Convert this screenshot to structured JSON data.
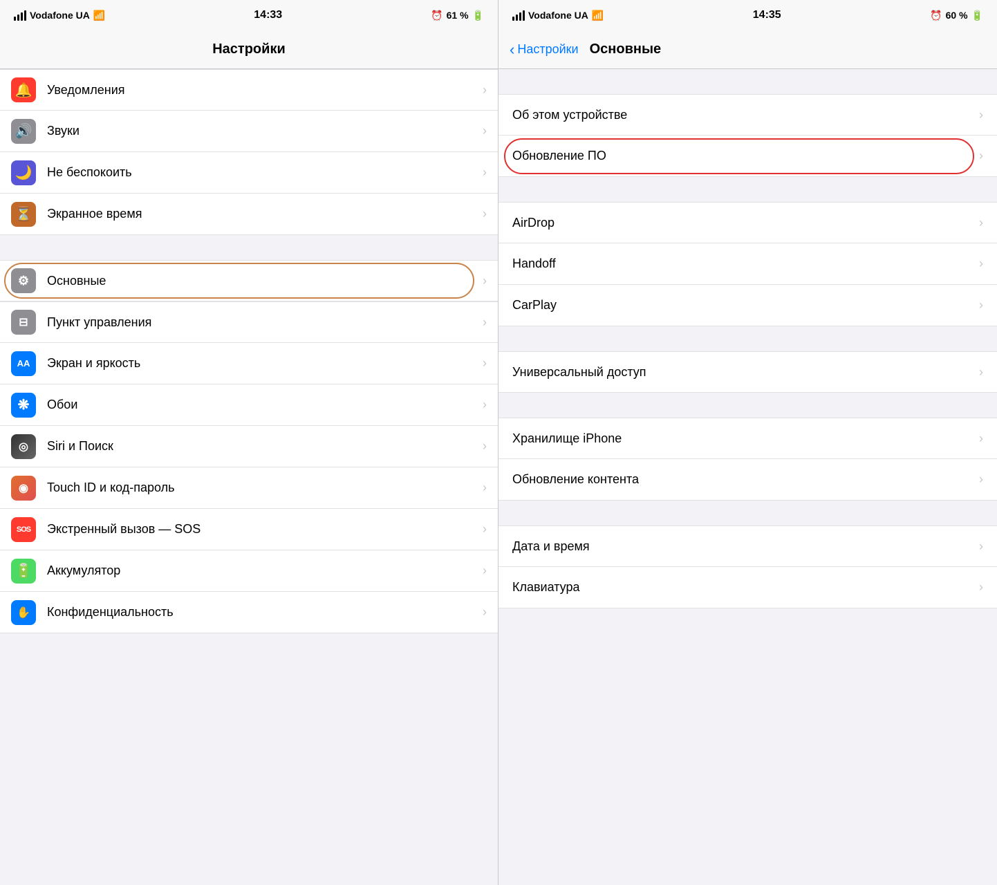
{
  "left_panel": {
    "status_bar": {
      "carrier": "Vodafone UA",
      "time": "14:33",
      "battery_percent": "61 %"
    },
    "nav_title": "Настройки",
    "items": [
      {
        "id": "notifications",
        "label": "Уведомления",
        "icon_color": "icon-red",
        "icon_symbol": "🔔",
        "highlighted": false
      },
      {
        "id": "sounds",
        "label": "Звуки",
        "icon_color": "icon-gray",
        "icon_symbol": "🔊",
        "highlighted": false
      },
      {
        "id": "donotdisturb",
        "label": "Не беспокоить",
        "icon_color": "icon-purple",
        "icon_symbol": "🌙",
        "highlighted": false
      },
      {
        "id": "screentime",
        "label": "Экранное время",
        "icon_color": "icon-orange-dark",
        "icon_symbol": "⏳",
        "highlighted": false
      }
    ],
    "divider1": true,
    "items2": [
      {
        "id": "general",
        "label": "Основные",
        "icon_color": "icon-settings",
        "icon_symbol": "⚙",
        "highlighted": true
      }
    ],
    "divider2": false,
    "items3": [
      {
        "id": "controlcenter",
        "label": "Пункт управления",
        "icon_color": "icon-toggle",
        "icon_symbol": "⊟",
        "highlighted": false
      },
      {
        "id": "display",
        "label": "Экран и яркость",
        "icon_color": "icon-blue",
        "icon_symbol": "AA",
        "highlighted": false
      },
      {
        "id": "wallpaper",
        "label": "Обои",
        "icon_color": "icon-flower",
        "icon_symbol": "❋",
        "highlighted": false
      },
      {
        "id": "siri",
        "label": "Siri и Поиск",
        "icon_color": "icon-siri",
        "icon_symbol": "◎",
        "highlighted": false
      },
      {
        "id": "touchid",
        "label": "Touch ID и код-пароль",
        "icon_color": "icon-touch",
        "icon_symbol": "◉",
        "highlighted": false
      },
      {
        "id": "sos",
        "label": "Экстренный вызов — SOS",
        "icon_color": "icon-sos",
        "icon_symbol": "SOS",
        "highlighted": false
      },
      {
        "id": "battery",
        "label": "Аккумулятор",
        "icon_color": "icon-battery",
        "icon_symbol": "🔋",
        "highlighted": false
      },
      {
        "id": "privacy",
        "label": "Конфиденциальность",
        "icon_color": "icon-privacy",
        "icon_symbol": "✋",
        "highlighted": false
      }
    ]
  },
  "right_panel": {
    "status_bar": {
      "carrier": "Vodafone UA",
      "time": "14:35",
      "battery_percent": "60 %"
    },
    "nav_back_label": "Настройки",
    "nav_title": "Основные",
    "sections": [
      {
        "items": [
          {
            "id": "about",
            "label": "Об этом устройстве",
            "highlighted": false
          },
          {
            "id": "software_update",
            "label": "Обновление ПО",
            "highlighted": true
          }
        ]
      },
      {
        "items": [
          {
            "id": "airdrop",
            "label": "AirDrop",
            "highlighted": false
          },
          {
            "id": "handoff",
            "label": "Handoff",
            "highlighted": false
          },
          {
            "id": "carplay",
            "label": "CarPlay",
            "highlighted": false
          }
        ]
      },
      {
        "items": [
          {
            "id": "accessibility",
            "label": "Универсальный доступ",
            "highlighted": false
          }
        ]
      },
      {
        "items": [
          {
            "id": "storage",
            "label": "Хранилище iPhone",
            "highlighted": false
          },
          {
            "id": "background_refresh",
            "label": "Обновление контента",
            "highlighted": false
          }
        ]
      },
      {
        "items": [
          {
            "id": "datetime",
            "label": "Дата и время",
            "highlighted": false
          },
          {
            "id": "keyboard",
            "label": "Клавиатура",
            "highlighted": false
          }
        ]
      }
    ]
  },
  "chevron": "›",
  "back_chevron": "‹"
}
